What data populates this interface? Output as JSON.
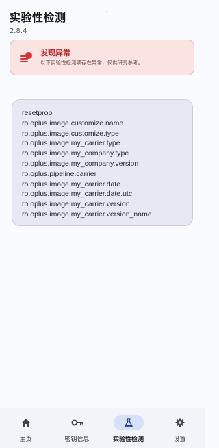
{
  "header": {
    "title": "实验性检测",
    "version": "2.8.4"
  },
  "alert": {
    "title": "发现异常",
    "description": "以下实验性检测项存在异常，仅供研究参考。",
    "icon": "alert-list-icon",
    "accent_color": "#d2343a"
  },
  "props": [
    "resetprop",
    "ro.oplus.image.customize.name",
    "ro.oplus.image.customize.type",
    "ro.oplus.image.my_carrier.type",
    "ro.oplus.image.my_company.type",
    "ro.oplus.image.my_company.version",
    "ro.oplus.pipeline.carrier",
    "ro.oplus.image.my_carrier.date",
    "ro.oplus.image.my_carrier.date.utc",
    "ro.oplus.image.my_carrier.version",
    "ro.oplus.image.my_carrier.version_name"
  ],
  "nav": {
    "items": [
      {
        "label": "主页",
        "icon": "home-icon"
      },
      {
        "label": "密钥信息",
        "icon": "key-icon"
      },
      {
        "label": "实验性检测",
        "icon": "flask-icon",
        "active": true
      },
      {
        "label": "设置",
        "icon": "gear-icon"
      }
    ]
  }
}
